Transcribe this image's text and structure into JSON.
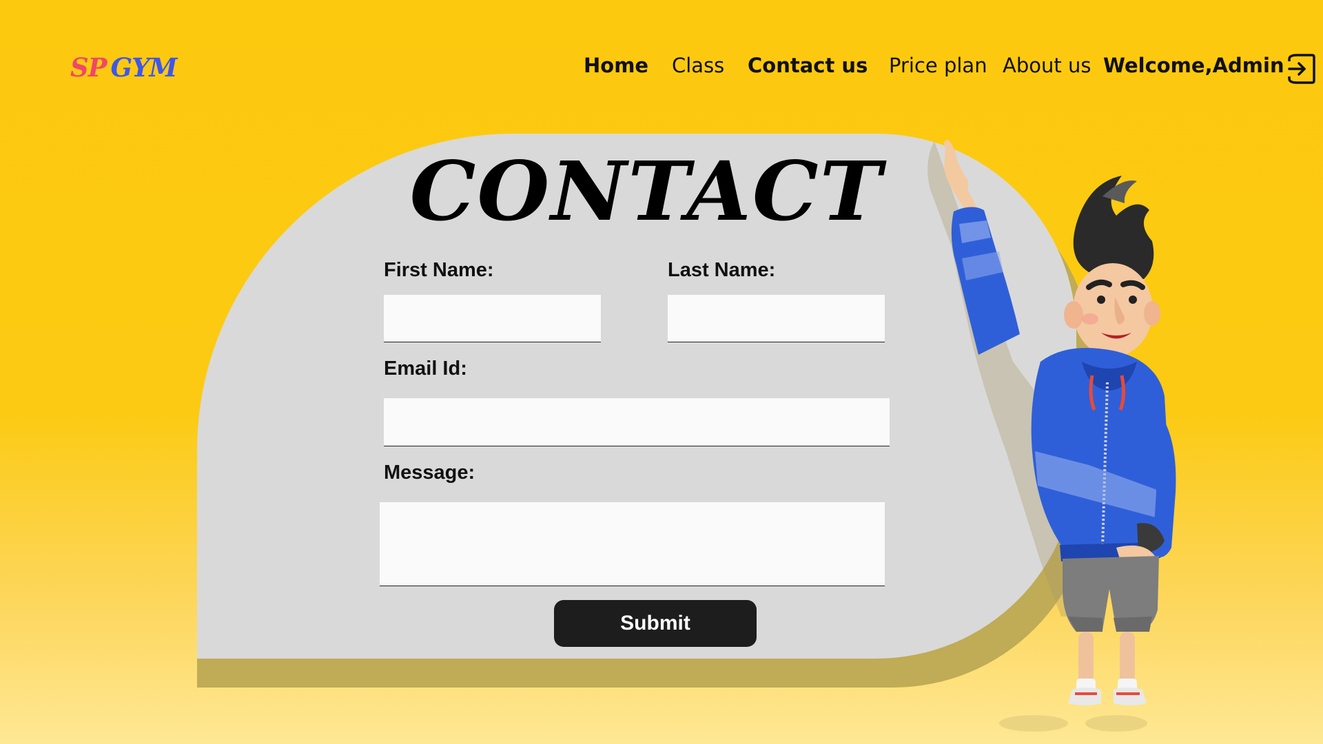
{
  "brand": {
    "logo_part1": "SP",
    "logo_part2": "GYM",
    "logo_color1": "#f0476a",
    "logo_color2": "#3f57e8"
  },
  "nav": {
    "home": "Home",
    "class": "Class",
    "contact": "Contact us",
    "price": "Price plan",
    "about": "About us",
    "welcome": "Welcome,Admin",
    "logout_icon": "logout-icon"
  },
  "form": {
    "title": "CONTACT",
    "first_name_label": "First Name:",
    "last_name_label": "Last Name:",
    "email_label": "Email Id:",
    "message_label": "Message:",
    "first_name_value": "",
    "last_name_value": "",
    "email_value": "",
    "message_value": "",
    "submit_label": "Submit"
  },
  "illustration": {
    "character": "waving-cartoon-man"
  },
  "colors": {
    "background": "#fdc90f",
    "card": "#d9d9d9",
    "button": "#1d1d1d",
    "input": "#fafafa"
  }
}
